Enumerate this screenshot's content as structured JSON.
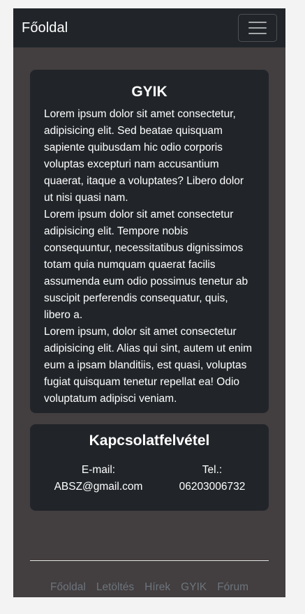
{
  "navbar": {
    "brand": "Főoldal",
    "toggler_icon": "hamburger-menu-icon"
  },
  "faq": {
    "title": "GYIK",
    "paragraphs": [
      "Lorem ipsum dolor sit amet consectetur, adipisicing elit. Sed beatae quisquam sapiente quibusdam hic odio corporis voluptas excepturi nam accusantium quaerat, itaque a voluptates? Libero dolor ut nisi quasi nam.",
      "Lorem ipsum dolor sit amet consectetur adipisicing elit. Tempore nobis consequuntur, necessitatibus dignissimos totam quia numquam quaerat facilis assumenda eum odio possimus tenetur ab suscipit perferendis consequatur, quis, libero a.",
      "Lorem ipsum, dolor sit amet consectetur adipisicing elit. Alias qui sint, autem ut enim eum a ipsam blanditiis, est quasi, voluptas fugiat quisquam tenetur repellat ea! Odio voluptatum adipisci veniam."
    ]
  },
  "contact": {
    "title": "Kapcsolatfelvétel",
    "email_label": "E-mail:",
    "email_value": "ABSZ@gmail.com",
    "phone_label": "Tel.:",
    "phone_value": "06203006732"
  },
  "footer": {
    "links": [
      "Főoldal",
      "Letöltés",
      "Hírek",
      "GYIK",
      "Fórum"
    ]
  },
  "colors": {
    "page_background": "#433e3f",
    "card_background": "#212529",
    "footer_link": "#6c757d"
  }
}
